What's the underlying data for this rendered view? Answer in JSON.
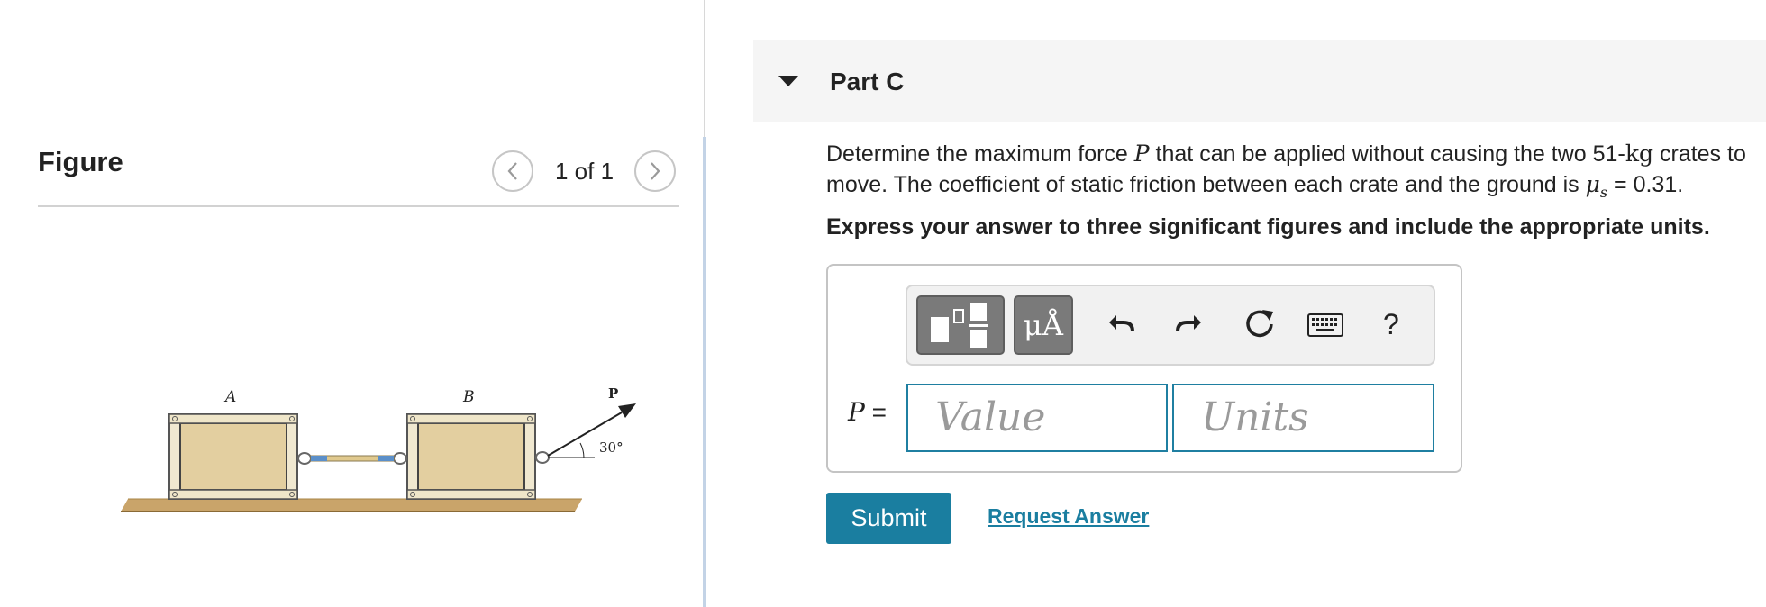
{
  "figure": {
    "title": "Figure",
    "pager": "1 of 1",
    "labels": {
      "crate_a": "A",
      "crate_b": "B",
      "force": "P",
      "angle": "30°"
    }
  },
  "part": {
    "title": "Part C",
    "question": {
      "t1": "Determine the maximum force ",
      "var_p": "P",
      "t2": " that can be applied without causing the two ",
      "mass_value": "51",
      "mass_unit": "-kg",
      "t3": " crates to",
      "t4": "move. The coefficient of static friction between each crate and the ground is ",
      "mu": "μ",
      "mu_sub": "s",
      "t5": " = 0.31."
    },
    "instruction": "Express your answer to three significant figures and include the appropriate units.",
    "toolbar": {
      "units_symbol": "μÅ",
      "help": "?"
    },
    "answer": {
      "var_label": "P",
      "equals": " =",
      "value_placeholder": "Value",
      "units_placeholder": "Units"
    },
    "submit_label": "Submit",
    "request_label": "Request Answer"
  },
  "colors": {
    "accent": "#1a7ea0",
    "divider": "#c3d3e6",
    "header_bg": "#f5f5f5"
  }
}
